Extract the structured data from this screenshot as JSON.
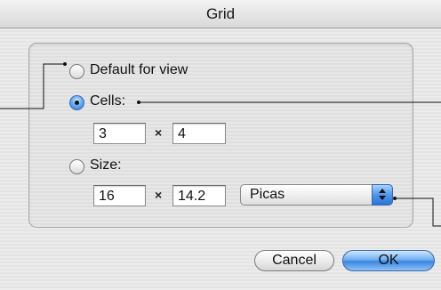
{
  "window": {
    "title": "Grid"
  },
  "options": {
    "default_label": "Default for view",
    "cells_label": "Cells:",
    "size_label": "Size:",
    "selected": "cells"
  },
  "cells": {
    "columns": "3",
    "separator": "×",
    "rows": "4"
  },
  "size": {
    "width": "16",
    "separator": "×",
    "height": "14.2"
  },
  "units": {
    "selected": "Picas"
  },
  "buttons": {
    "cancel": "Cancel",
    "ok": "OK"
  }
}
